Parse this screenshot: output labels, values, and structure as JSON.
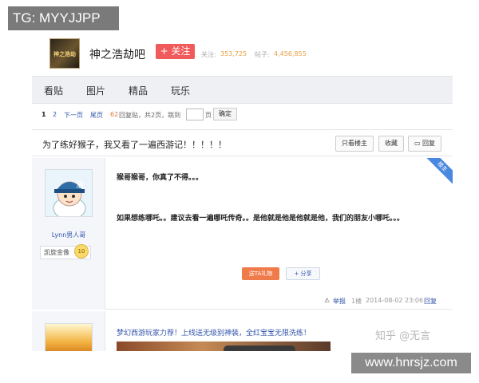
{
  "overlay": {
    "tg_label": "TG: MYYJJPP",
    "watermark_zhihu": "知乎 @无言",
    "url_badge": "www.hnrsjz.com"
  },
  "forum": {
    "logo_text": "神之浩劫",
    "name": "神之浩劫吧",
    "follow_label": "+ 关注",
    "followers_label": "关注:",
    "followers_value": "353,725",
    "posts_label": "帖子:",
    "posts_value": "4,456,855"
  },
  "nav": {
    "tabs": [
      {
        "label": "看贴"
      },
      {
        "label": "图片"
      },
      {
        "label": "精品"
      },
      {
        "label": "玩乐"
      }
    ]
  },
  "pager": {
    "current_page": "1",
    "page_2": "2",
    "next_label": "下一页",
    "last_label": "尾页",
    "replies_count": "62",
    "replies_text": "回复贴，共2页，跳到",
    "page_suffix": "页",
    "confirm_label": "确定"
  },
  "thread": {
    "title": "为了练好猴子，我又看了一遍西游记！！！！！",
    "only_op_label": "只看楼主",
    "favorite_label": "收藏",
    "reply_label": "回复"
  },
  "post": {
    "corner_tag": "楼主",
    "username": "Lynn男人哥",
    "badge_label": "凯旋金像",
    "level": "10",
    "line1": "猴哥猴哥，你真了不得。。。",
    "line2": "如果想练哪吒。。建议去看一遍哪吒传奇。。是他就是他是他就是他，我们的朋友小哪吒。。。",
    "gift_label": "送TA礼物",
    "share_label": "分享",
    "report_label": "举报",
    "floor": "1楼",
    "datetime": "2014-08-02 23:06",
    "reply_label": "回复"
  },
  "post2": {
    "text": "梦幻西游玩家力荐！上线送无级别神装，全红宝宝无限洗练！"
  }
}
